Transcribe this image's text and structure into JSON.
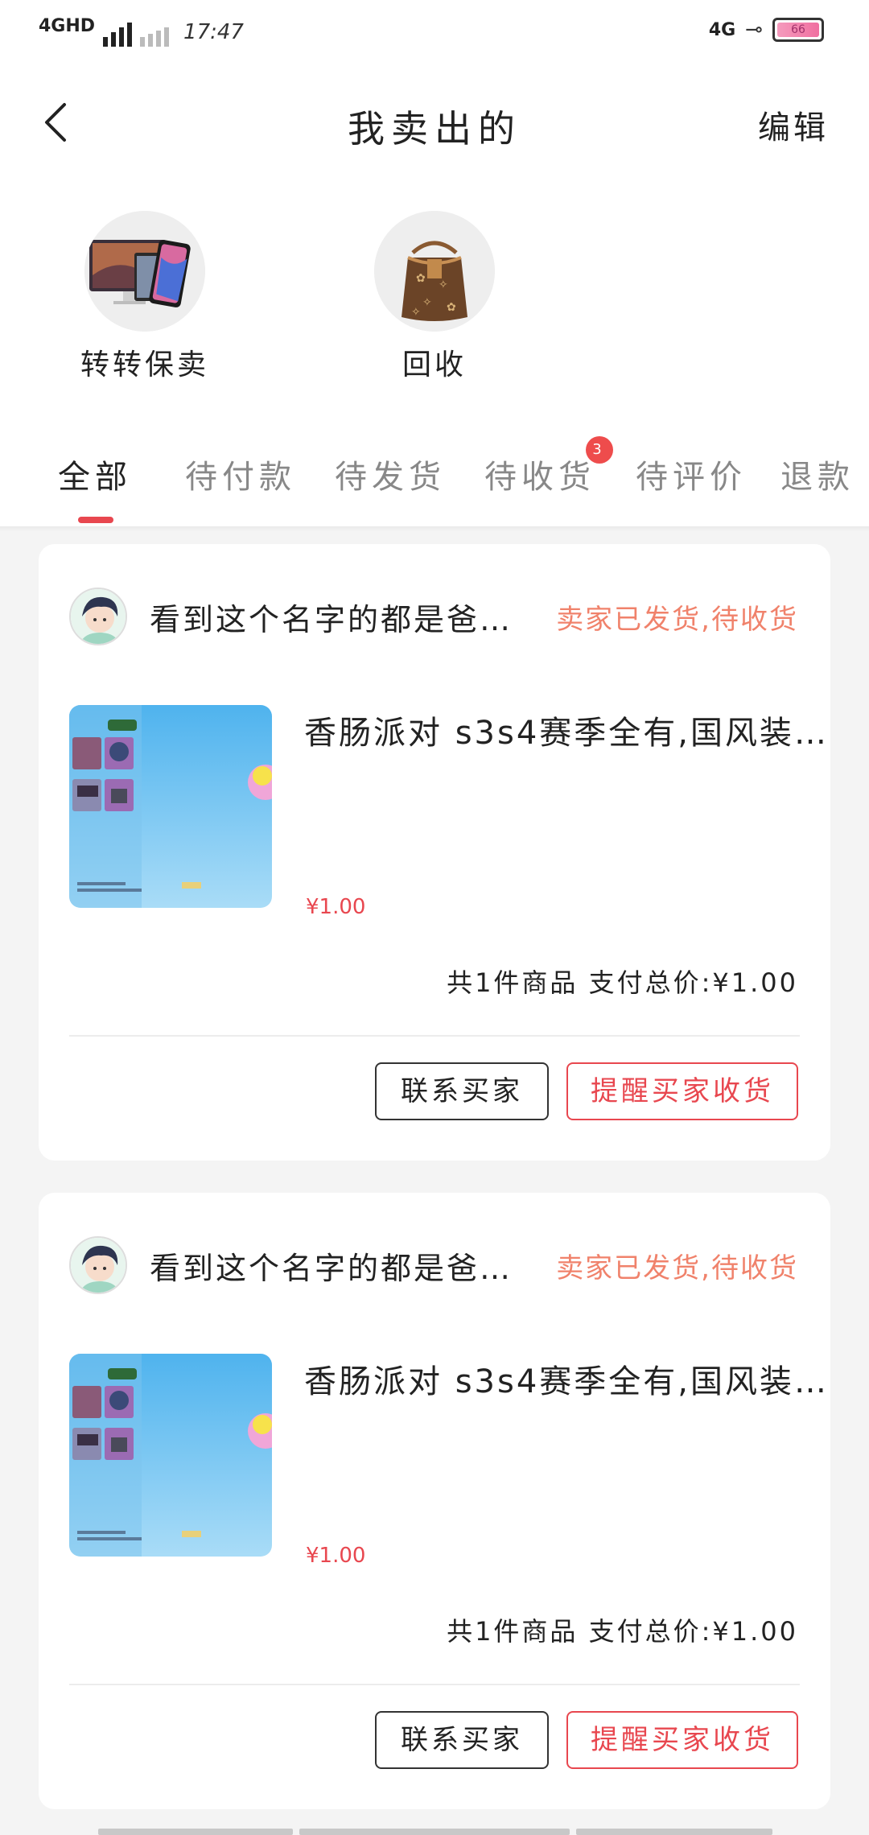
{
  "status_bar": {
    "network": "4GHD",
    "time": "17:47",
    "network_right": "4G",
    "battery": "66"
  },
  "nav": {
    "title": "我卖出的",
    "edit_label": "编辑"
  },
  "categories": [
    {
      "label": "转转保卖",
      "icon": "electronics-devices-icon"
    },
    {
      "label": "回收",
      "icon": "handbag-icon"
    }
  ],
  "tabs": [
    {
      "label": "全部",
      "active": true
    },
    {
      "label": "待付款"
    },
    {
      "label": "待发货"
    },
    {
      "label": "待收货",
      "badge": "3"
    },
    {
      "label": "待评价"
    },
    {
      "label": "退款"
    }
  ],
  "orders": [
    {
      "seller_name": "看到这个名字的都是爸…",
      "status": "卖家已发货,待收货",
      "item_title": "香肠派对 s3s4赛季全有,国风装…",
      "price": "¥1.00",
      "summary": "共1件商品 支付总价:¥1.00",
      "contact_label": "联系买家",
      "remind_label": "提醒买家收货"
    },
    {
      "seller_name": "看到这个名字的都是爸…",
      "status": "卖家已发货,待收货",
      "item_title": "香肠派对 s3s4赛季全有,国风装…",
      "price": "¥1.00",
      "summary": "共1件商品 支付总价:¥1.00",
      "contact_label": "联系买家",
      "remind_label": "提醒买家收货"
    }
  ],
  "colors": {
    "accent": "#e8474f",
    "status_text": "#f0826b",
    "background": "#f4f4f4"
  }
}
